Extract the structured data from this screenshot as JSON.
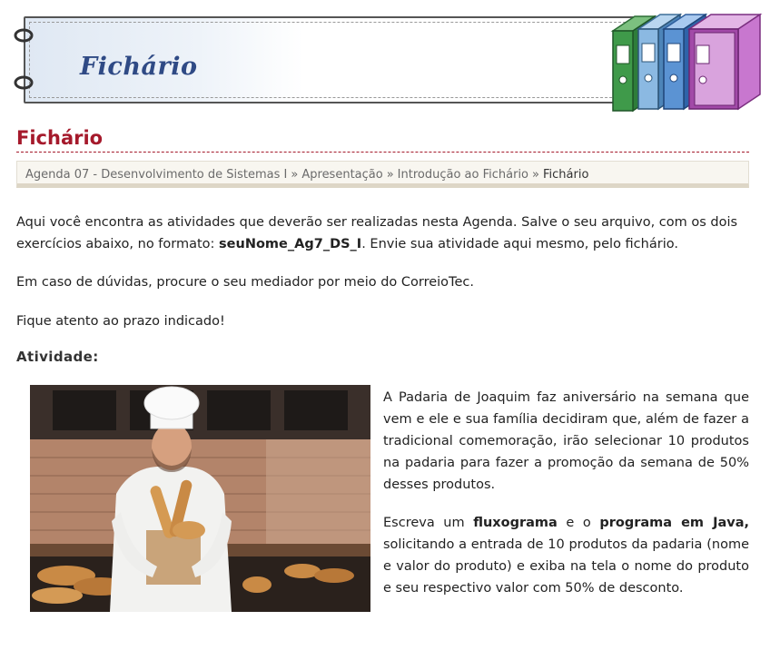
{
  "banner": {
    "title": "Fichário"
  },
  "page_title": "Fichário",
  "breadcrumb": {
    "items": [
      "Agenda 07 - Desenvolvimento de Sistemas I",
      "Apresentação",
      "Introdução ao Fichário"
    ],
    "current": "Fichário",
    "separator": "»"
  },
  "intro": {
    "p1_before": "Aqui você encontra as atividades que deverão ser realizadas nesta Agenda. Salve o seu arquivo, com os dois exercícios abaixo, no formato: ",
    "p1_bold": "seuNome_Ag7_DS_I",
    "p1_after": ". Envie sua atividade aqui mesmo, pelo fichário.",
    "p2": "Em caso de dúvidas, procure o seu mediador por meio do CorreioTec.",
    "p3": "Fique atento ao prazo indicado!"
  },
  "activity": {
    "heading": "Atividade:",
    "p1": "A Padaria de Joaquim faz aniversário na semana que vem e ele e sua família decidiram que, além de fazer a tradicional comemoração, irão selecionar 10 produtos na padaria para fazer a promoção da semana de 50% desses produtos.",
    "p2_a": "Escreva um ",
    "p2_b1": "fluxograma",
    "p2_c": " e o ",
    "p2_b2": "programa em Java,",
    "p2_d": " solicitando a entrada de 10 produtos da padaria (nome e valor do produto) e exiba na tela o nome do produto e seu respectivo valor com 50% de desconto."
  },
  "colors": {
    "title_red": "#a5192b",
    "banner_blue": "#2f4a85",
    "binder_green": "#3f9a4a",
    "binder_lightblue": "#6fa6d6",
    "binder_blue": "#4f86c8",
    "binder_purple": "#a24aa8"
  },
  "icons": [
    "binder-ring-icon",
    "binders-icon",
    "baker-photo"
  ]
}
